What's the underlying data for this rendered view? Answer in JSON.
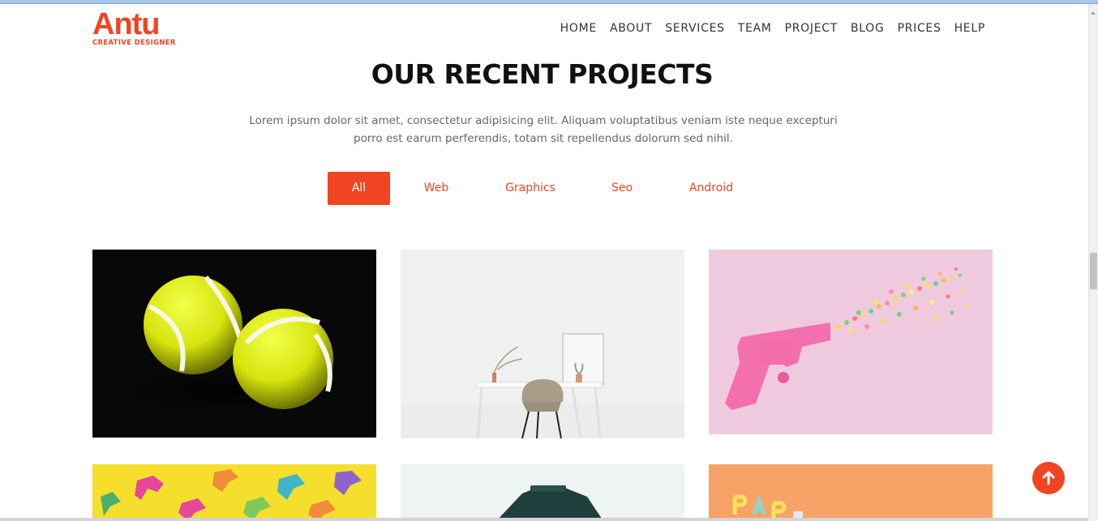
{
  "header": {
    "logo_name": "Antu",
    "logo_tagline": "CREATIVE DESIGNER",
    "nav": [
      "HOME",
      "ABOUT",
      "SERVICES",
      "TEAM",
      "PROJECT",
      "BLOG",
      "PRICES",
      "HELP"
    ]
  },
  "section": {
    "title": "OUR RECENT PROJECTS",
    "description": "Lorem ipsum dolor sit amet, consectetur adipisicing elit. Aliquam voluptatibus veniam iste neque excepturi porro est earum perferendis, totam sit repellendus dolorum sed nihil.",
    "filters": [
      {
        "label": "All",
        "active": true
      },
      {
        "label": "Web",
        "active": false
      },
      {
        "label": "Graphics",
        "active": false
      },
      {
        "label": "Seo",
        "active": false
      },
      {
        "label": "Android",
        "active": false
      }
    ]
  },
  "projects": [
    {
      "image": "tennis-balls-photo"
    },
    {
      "image": "white-desk-chair-photo"
    },
    {
      "image": "pink-toy-gun-sprinkles-photo"
    },
    {
      "image": "toy-dinosaurs-yellow-photo"
    },
    {
      "image": "typewriter-photo"
    },
    {
      "image": "party-letters-orange-photo"
    }
  ],
  "colors": {
    "accent": "#f04423",
    "heading": "#111111",
    "body_text": "#666666",
    "nav_text": "#333333"
  },
  "icons": {
    "back_to_top": "arrow-up-icon"
  }
}
